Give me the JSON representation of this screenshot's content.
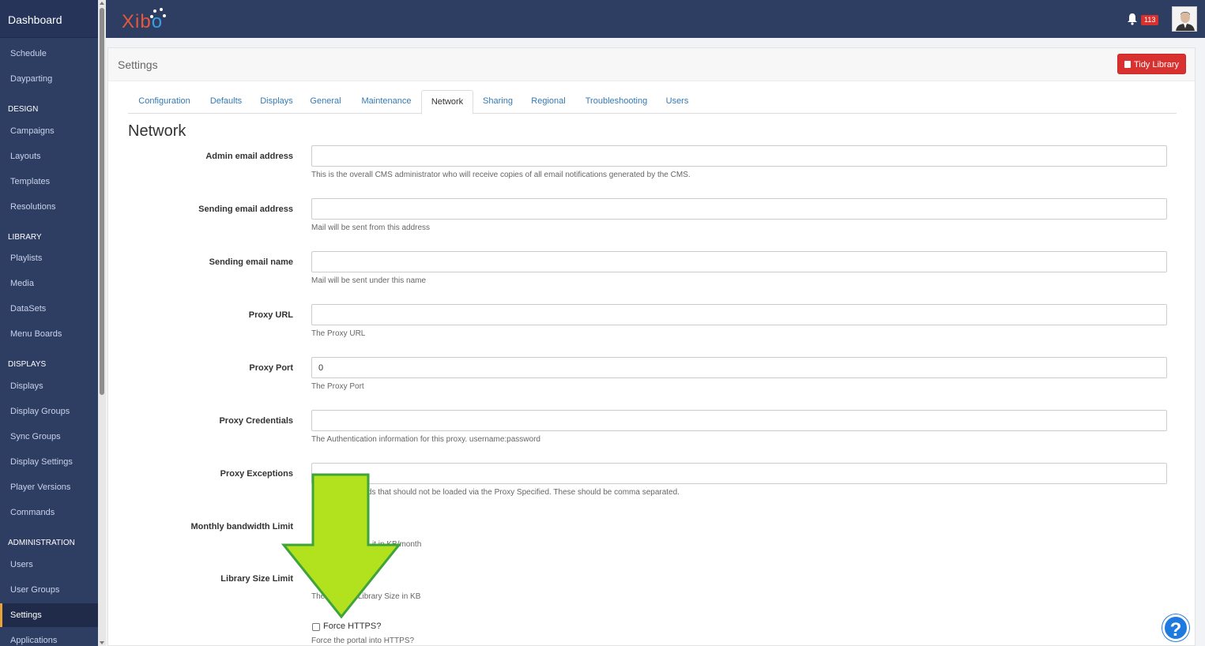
{
  "sidebar": {
    "brand": "Dashboard",
    "items": [
      {
        "label": "Schedule"
      },
      {
        "label": "Dayparting"
      },
      {
        "label": "Campaigns"
      },
      {
        "label": "Layouts"
      },
      {
        "label": "Templates"
      },
      {
        "label": "Resolutions"
      },
      {
        "label": "Playlists"
      },
      {
        "label": "Media"
      },
      {
        "label": "DataSets"
      },
      {
        "label": "Menu Boards"
      },
      {
        "label": "Displays"
      },
      {
        "label": "Display Groups"
      },
      {
        "label": "Sync Groups"
      },
      {
        "label": "Display Settings"
      },
      {
        "label": "Player Versions"
      },
      {
        "label": "Commands"
      },
      {
        "label": "Users"
      },
      {
        "label": "User Groups"
      },
      {
        "label": "Settings"
      },
      {
        "label": "Applications"
      }
    ],
    "headings": [
      "DESIGN",
      "LIBRARY",
      "DISPLAYS",
      "ADMINISTRATION"
    ]
  },
  "topbar": {
    "logo_main": "Xib",
    "logo_o": "o",
    "notifications_count": "113"
  },
  "header": {
    "title": "Settings",
    "tidy_button": "Tidy Library"
  },
  "tabs": [
    "Configuration",
    "Defaults",
    "Displays",
    "General",
    "Maintenance",
    "Network",
    "Sharing",
    "Regional",
    "Troubleshooting",
    "Users"
  ],
  "active_tab": "Network",
  "section_title": "Network",
  "fields": [
    {
      "label": "Admin email address",
      "value": "",
      "help": "This is the overall CMS administrator who will receive copies of all email notifications generated by the CMS."
    },
    {
      "label": "Sending email address",
      "value": "",
      "help": "Mail will be sent from this address"
    },
    {
      "label": "Sending email name",
      "value": "",
      "help": "Mail will be sent under this name"
    },
    {
      "label": "Proxy URL",
      "value": "",
      "help": "The Proxy URL"
    },
    {
      "label": "Proxy Port",
      "value": "0",
      "help": "The Proxy Port"
    },
    {
      "label": "Proxy Credentials",
      "value": "",
      "help": "The Authentication information for this proxy. username:password"
    },
    {
      "label": "Proxy Exceptions",
      "value": "",
      "help": "ords that should not be loaded via the Proxy Specified. These should be comma separated."
    },
    {
      "label": "Monthly bandwidth Limit",
      "value": "",
      "help": "it in KB/month"
    },
    {
      "label": "Library Size Limit",
      "value": "",
      "help": "The         the Library Size in KB"
    }
  ],
  "force_https": {
    "label": "Force HTTPS?",
    "help": "Force the portal into HTTPS?",
    "checked": false
  },
  "help_bubble": "?",
  "colors": {
    "sidebar_bg": "#2e3d62",
    "accent_red": "#d9312f",
    "link_blue": "#337ab7",
    "arrow_green": "#b0e020"
  }
}
